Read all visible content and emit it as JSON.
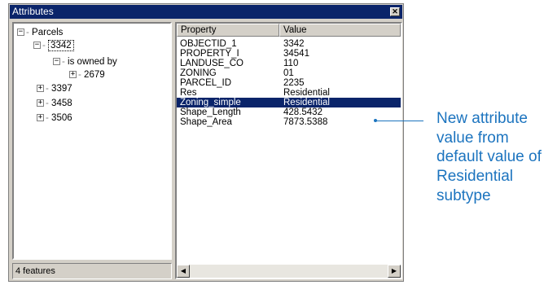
{
  "window": {
    "title": "Attributes",
    "close_glyph": "✕"
  },
  "tree": {
    "nodes": [
      {
        "toggle": "−",
        "label": "Parcels"
      },
      {
        "toggle": "−",
        "label": "3342"
      },
      {
        "toggle": "−",
        "label": "is owned by"
      },
      {
        "toggle": "+",
        "label": "2679"
      },
      {
        "toggle": "+",
        "label": "3397"
      },
      {
        "toggle": "+",
        "label": "3458"
      },
      {
        "toggle": "+",
        "label": "3506"
      }
    ]
  },
  "status": {
    "text": "4 features"
  },
  "grid": {
    "headers": {
      "property": "Property",
      "value": "Value"
    },
    "rows": [
      {
        "property": "OBJECTID_1",
        "value": "3342"
      },
      {
        "property": "PROPERTY_I",
        "value": "34541"
      },
      {
        "property": "LANDUSE_CO",
        "value": "110"
      },
      {
        "property": "ZONING",
        "value": "01"
      },
      {
        "property": "PARCEL_ID",
        "value": "2235"
      },
      {
        "property": "Res",
        "value": "Residential"
      },
      {
        "property": "Zoning_simple",
        "value": "Residential"
      },
      {
        "property": "Shape_Length",
        "value": "428.5432"
      },
      {
        "property": "Shape_Area",
        "value": "7873.5388"
      }
    ],
    "selected_row": 6,
    "scroll_left": "◀",
    "scroll_right": "▶"
  },
  "callout": {
    "text": "New attribute value from default value of Residential subtype",
    "color": "#1c74bf"
  }
}
